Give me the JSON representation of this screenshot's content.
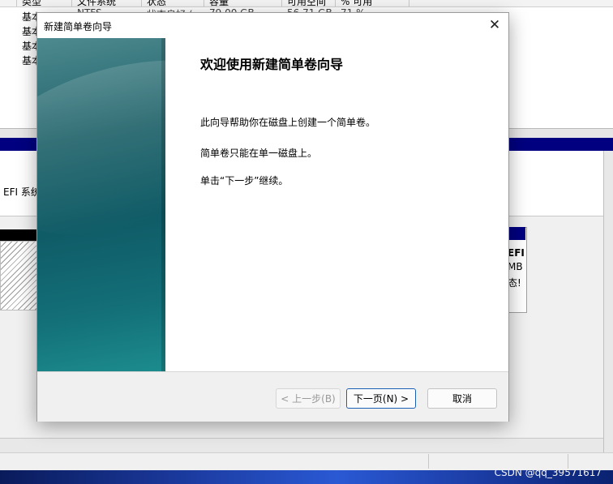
{
  "background": {
    "column_headers": [
      "类型",
      "文件系统",
      "状态",
      "容量",
      "可用空间",
      "% 可用"
    ],
    "cut_cells": [
      "NTFS",
      "状态良好 (",
      "79.00 GB",
      "56.71 GB",
      "71 %"
    ],
    "row_labels": [
      "基本",
      "基本",
      "基本",
      "基本"
    ],
    "partition_fragment": "EFI 系统分",
    "right_fragments": [
      "EFI",
      "MB",
      "态!"
    ]
  },
  "dialog": {
    "title": "新建简单卷向导",
    "close_glyph": "✕",
    "heading": "欢迎使用新建简单卷向导",
    "paragraphs": [
      "此向导帮助你在磁盘上创建一个简单卷。",
      "简单卷只能在单一磁盘上。",
      "单击“下一步”继续。"
    ],
    "buttons": {
      "back": "< 上一步(B)",
      "next": "下一页(N) >",
      "cancel": "取消"
    }
  },
  "watermark": "CSDN @qq_39571617",
  "colors": {
    "accent_border": "#1b5fb5",
    "banner_teal": "#0f5b66",
    "disk_bar_navy": "#000080"
  }
}
